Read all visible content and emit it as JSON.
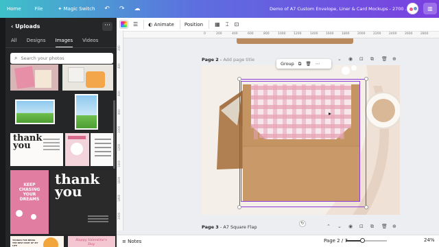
{
  "topbar": {
    "home": "Home",
    "file": "File",
    "magic_switch": "Magic Switch",
    "doc_title": "Demo of A7 Custom Envelope, Liner & Card Mockups - 2700 ..."
  },
  "panel": {
    "title": "Uploads",
    "tabs": [
      "All",
      "Designs",
      "Images",
      "Videos"
    ],
    "active_tab": "Images",
    "search_placeholder": "Search your photos",
    "thumbs": {
      "thank_you_1": "thank you",
      "keep_chasing": "KEEP CHASING YOUR DREAMS",
      "thank_you_2": "thank you",
      "thanks_best_part": "THANKS FOR BEING THE BEST PART OF MY LIFE",
      "valentines": "Happy Valentine's Day"
    }
  },
  "toolbar": {
    "animate": "Animate",
    "position": "Position"
  },
  "ruler_top": [
    "0",
    "200",
    "400",
    "600",
    "800",
    "1000",
    "1200",
    "1400",
    "1600",
    "1800",
    "2000",
    "2200",
    "2400",
    "2600",
    "2800"
  ],
  "ruler_left": [
    "200",
    "400",
    "600",
    "800",
    "1000",
    "1200",
    "1400",
    "1600",
    "1800",
    "2000"
  ],
  "page2": {
    "label": "Page 2",
    "sub": "Add page title"
  },
  "page3": {
    "label": "Page 3",
    "sub": "A7 Square Flap"
  },
  "group_tip": {
    "label": "Group"
  },
  "bottom": {
    "notes": "Notes",
    "page_indicator": "Page 2 / 7",
    "zoom": "24%",
    "zoom_level": 0.4
  },
  "colors": {
    "selection": "#8b3ddb",
    "kraft": "#c49463",
    "gingham": "#e8a3b6"
  }
}
